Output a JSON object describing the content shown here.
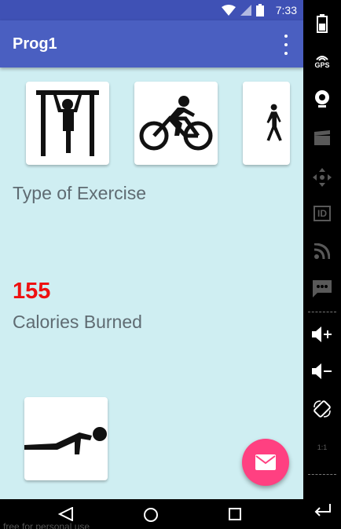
{
  "status_bar": {
    "time": "7:33"
  },
  "app_bar": {
    "title": "Prog1"
  },
  "exercise": {
    "type_label": "Type of Exercise",
    "calories_value": "155",
    "calories_label": "Calories Burned",
    "icons": [
      "pullup-icon",
      "cycling-icon",
      "walking-icon",
      "pushup-icon"
    ]
  },
  "emulator_panel": {
    "gps_label": "GPS",
    "id_label": "ID",
    "ratio_label": "1:1"
  },
  "watermark": "free for personal use",
  "colors": {
    "app_bar": "#4a5fc1",
    "status_bar": "#3f51b5",
    "background": "#cfeef2",
    "calories": "#ee1111",
    "fab": "#ff4081"
  }
}
